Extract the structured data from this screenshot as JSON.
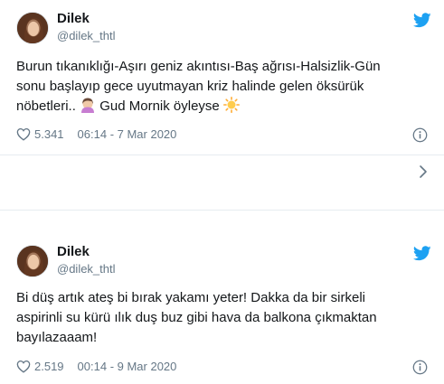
{
  "tweets": [
    {
      "author": "Dilek",
      "handle": "@dilek_thtl",
      "lines": [
        "Burun tıkanıklığı-Aşırı geniz akıntısı-Baş ağrısı-Halsizlik-Gün",
        "sonu başlayıp gece uyutmayan kriz halinde gelen öksürük",
        "nöbetleri..",
        "Gud Mornik öyleyse"
      ],
      "likes": "5.341",
      "timestamp": "06:14 - 7 Mar 2020",
      "emojis": [
        "facepalm-woman-emoji",
        "sun-emoji"
      ]
    },
    {
      "author": "Dilek",
      "handle": "@dilek_thtl",
      "lines": [
        "Bi düş artık ateş bi bırak yakamı yeter! Dakka da bir sirkeli",
        "aspirinli su kürü ılık duş buz gibi hava da balkona çıkmaktan",
        "bayılazaaam!"
      ],
      "likes": "2.519",
      "timestamp": "00:14 - 9 Mar 2020"
    }
  ],
  "icons": {
    "brand": "twitter-bird-icon",
    "like": "heart-icon",
    "info": "info-icon",
    "more": "chevron-right-icon"
  },
  "colors": {
    "twitter_blue": "#1da1f2",
    "text": "#14171a",
    "muted": "#657786",
    "divider": "#e6ecf0"
  }
}
